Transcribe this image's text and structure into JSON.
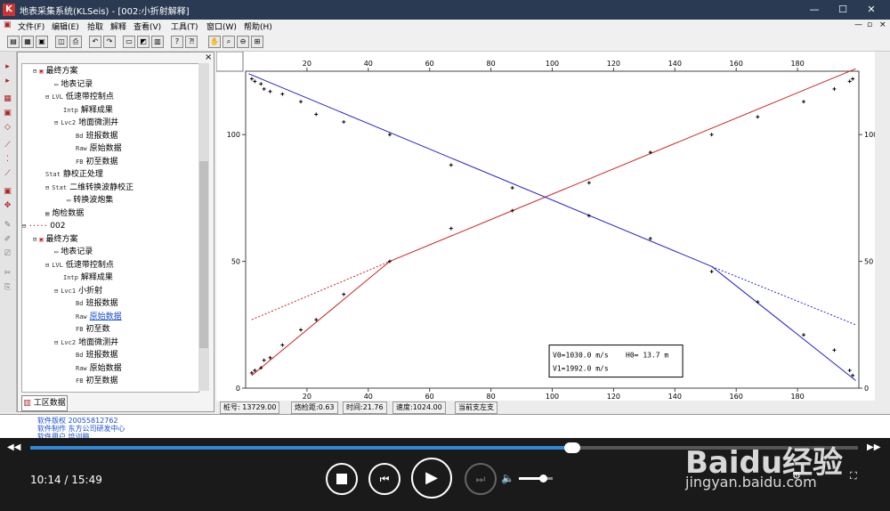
{
  "window": {
    "title": "地表采集系统(KLSeis) - [002:小折射解释]",
    "controls": [
      "—",
      "☐",
      "✕"
    ]
  },
  "menu": [
    "文件(F)",
    "编辑(E)",
    "拾取",
    "解释",
    "查看(V)",
    "工具(T)",
    "窗口(W)",
    "帮助(H)"
  ],
  "tree": {
    "items": [
      {
        "indent": 58,
        "icon": "⊟",
        "tag": "▣",
        "label": "最终方案",
        "red": true
      },
      {
        "indent": 82,
        "icon": "",
        "tag": "▭",
        "label": "地表记录"
      },
      {
        "indent": 72,
        "icon": "⊟",
        "tag": "LVL",
        "label": "低速带控制点"
      },
      {
        "indent": 92,
        "icon": "",
        "tag": "Intp",
        "label": "解释成果"
      },
      {
        "indent": 82,
        "icon": "⊟",
        "tag": "Lvc2",
        "label": "地面微测井"
      },
      {
        "indent": 106,
        "icon": "",
        "tag": "Bd",
        "label": "班报数据"
      },
      {
        "indent": 106,
        "icon": "",
        "tag": "Raw",
        "label": "原始数据"
      },
      {
        "indent": 106,
        "icon": "",
        "tag": "FB",
        "label": "初至数据"
      },
      {
        "indent": 72,
        "icon": "",
        "tag": "Stat",
        "label": "静校正处理"
      },
      {
        "indent": 72,
        "icon": "⊟",
        "tag": "Stat",
        "label": "二维转换波静校正"
      },
      {
        "indent": 96,
        "icon": "",
        "tag": "▭",
        "label": "转换波炮集"
      },
      {
        "indent": 72,
        "icon": "",
        "tag": "▤",
        "label": "炮检数据"
      },
      {
        "indent": 46,
        "icon": "⊟",
        "tag": "·····",
        "label": "002",
        "red": true
      },
      {
        "indent": 58,
        "icon": "⊟",
        "tag": "▣",
        "label": "最终方案",
        "red": true
      },
      {
        "indent": 82,
        "icon": "",
        "tag": "▭",
        "label": "地表记录"
      },
      {
        "indent": 72,
        "icon": "⊟",
        "tag": "LVL",
        "label": "低速带控制点"
      },
      {
        "indent": 92,
        "icon": "",
        "tag": "Intp",
        "label": "解释成果"
      },
      {
        "indent": 82,
        "icon": "⊟",
        "tag": "Lvc1",
        "label": "小折射"
      },
      {
        "indent": 106,
        "icon": "",
        "tag": "Bd",
        "label": "班报数据"
      },
      {
        "indent": 106,
        "icon": "",
        "tag": "Raw",
        "label": "原始数据",
        "link": true
      },
      {
        "indent": 106,
        "icon": "",
        "tag": "FB",
        "label": "初至数"
      },
      {
        "indent": 82,
        "icon": "⊟",
        "tag": "Lvc2",
        "label": "地面微测井"
      },
      {
        "indent": 106,
        "icon": "",
        "tag": "Bd",
        "label": "班报数据"
      },
      {
        "indent": 106,
        "icon": "",
        "tag": "Raw",
        "label": "原始数据"
      },
      {
        "indent": 106,
        "icon": "",
        "tag": "FB",
        "label": "初至数据"
      }
    ],
    "tab_label": "工区数据"
  },
  "chart_data": {
    "type": "scatter",
    "xlim": [
      0,
      200
    ],
    "ylim": [
      0,
      125
    ],
    "xticks": [
      20,
      40,
      60,
      80,
      100,
      120,
      140,
      160,
      180
    ],
    "yticks": [
      0,
      50,
      100
    ],
    "annotation": {
      "v0": "V0=1030.0 m/s",
      "h0": "H0=  13.7 m",
      "v1": "V1=1992.0 m/s"
    },
    "series": [
      {
        "color": "#cc2222",
        "points": [
          [
            2,
            6
          ],
          [
            3,
            7
          ],
          [
            5,
            8
          ],
          [
            6,
            11
          ],
          [
            8,
            12
          ],
          [
            12,
            17
          ],
          [
            18,
            23
          ],
          [
            23,
            27
          ],
          [
            32,
            37
          ],
          [
            47,
            50
          ],
          [
            67,
            63
          ],
          [
            87,
            70
          ],
          [
            112,
            81
          ],
          [
            132,
            93
          ],
          [
            152,
            100
          ],
          [
            167,
            107
          ],
          [
            182,
            113
          ],
          [
            192,
            118
          ],
          [
            197,
            121
          ],
          [
            198,
            122
          ]
        ],
        "fit_lines": [
          {
            "x": [
              2,
              47
            ],
            "y": [
              5,
              50
            ]
          },
          {
            "x": [
              47,
              199
            ],
            "y": [
              50,
              126
            ]
          },
          {
            "x": [
              2,
              47
            ],
            "y": [
              27,
              50
            ],
            "dashed": true
          }
        ]
      },
      {
        "color": "#2222cc",
        "points": [
          [
            2,
            122
          ],
          [
            3,
            121
          ],
          [
            5,
            120
          ],
          [
            6,
            118
          ],
          [
            8,
            117
          ],
          [
            12,
            116
          ],
          [
            18,
            113
          ],
          [
            23,
            108
          ],
          [
            32,
            105
          ],
          [
            47,
            100
          ],
          [
            67,
            88
          ],
          [
            87,
            79
          ],
          [
            112,
            68
          ],
          [
            132,
            59
          ],
          [
            152,
            46
          ],
          [
            167,
            34
          ],
          [
            182,
            21
          ],
          [
            192,
            15
          ],
          [
            197,
            7
          ],
          [
            198,
            5
          ]
        ],
        "fit_lines": [
          {
            "x": [
              1,
              152
            ],
            "y": [
              124,
              48
            ]
          },
          {
            "x": [
              152,
              199
            ],
            "y": [
              48,
              3
            ]
          },
          {
            "x": [
              152,
              199
            ],
            "y": [
              48,
              25
            ],
            "dashed": true
          }
        ]
      }
    ]
  },
  "status": [
    "桩号: 13729.00",
    "炮检距:0.63",
    "时间:21.76",
    "速度:1024.00",
    "当前支左支"
  ],
  "output": [
    "软件版权  20055812762",
    "软件制作  东方公司研发中心",
    "软件用户  培训稿"
  ],
  "player": {
    "time": "10:14 / 15:49",
    "progress": 0.655,
    "volume": 0.7,
    "brand": "Baidu经验",
    "brand_url": "jingyan.baidu.com"
  }
}
